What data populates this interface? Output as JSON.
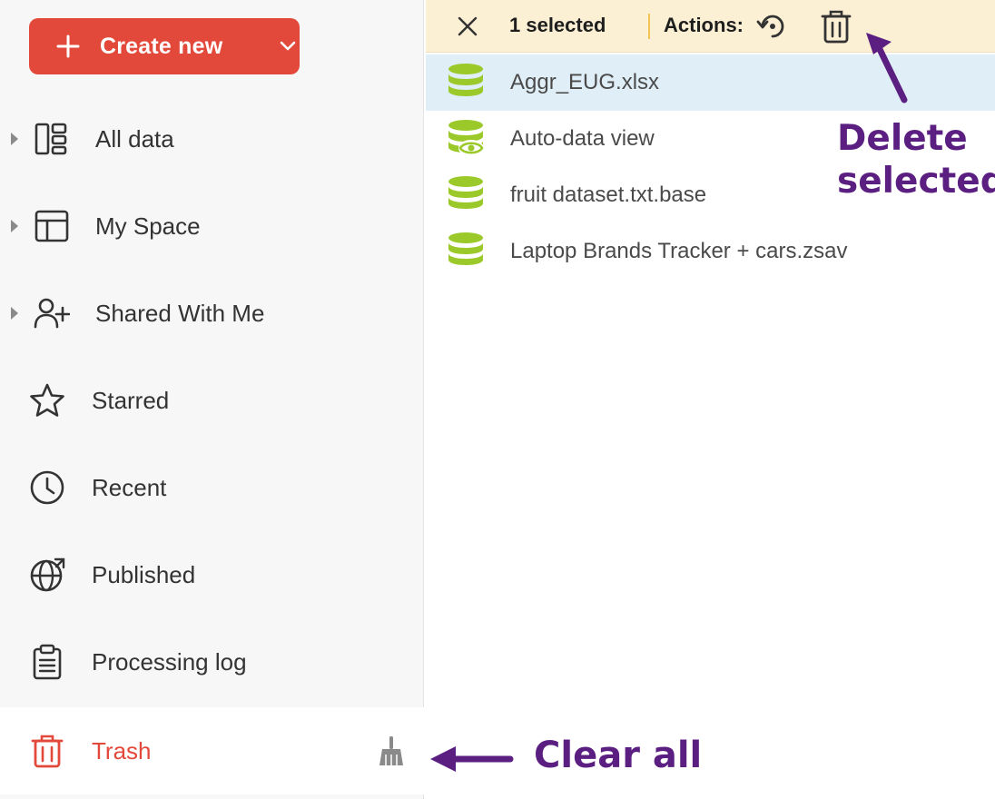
{
  "sidebar": {
    "create_label": "Create new",
    "items": [
      {
        "label": "All data",
        "icon": "all-data-icon"
      },
      {
        "label": "My Space",
        "icon": "layout-icon"
      },
      {
        "label": "Shared With Me",
        "icon": "user-plus-icon"
      },
      {
        "label": "Starred",
        "icon": "star-icon"
      },
      {
        "label": "Recent",
        "icon": "clock-icon"
      },
      {
        "label": "Published",
        "icon": "globe-icon"
      },
      {
        "label": "Processing log",
        "icon": "clipboard-icon"
      },
      {
        "label": "Trash",
        "icon": "trash-icon"
      }
    ]
  },
  "toolbar": {
    "selected_text": "1 selected",
    "actions_label": "Actions:"
  },
  "files": [
    {
      "name": "Aggr_EUG.xlsx",
      "icon": "database-icon"
    },
    {
      "name": "Auto-data view",
      "icon": "database-view-icon"
    },
    {
      "name": "fruit dataset.txt.base",
      "icon": "database-icon"
    },
    {
      "name": "Laptop Brands Tracker + cars.zsav",
      "icon": "database-icon"
    }
  ],
  "annotations": {
    "delete_line1": "Delete",
    "delete_line2": "selected",
    "clear_all": "Clear all"
  },
  "colors": {
    "accent": "#e3493b",
    "toolbar_bg": "#fcf0d4",
    "selected_row": "#e0eef7",
    "db_icon": "#9bc92a",
    "annotation": "#5b1f82"
  }
}
